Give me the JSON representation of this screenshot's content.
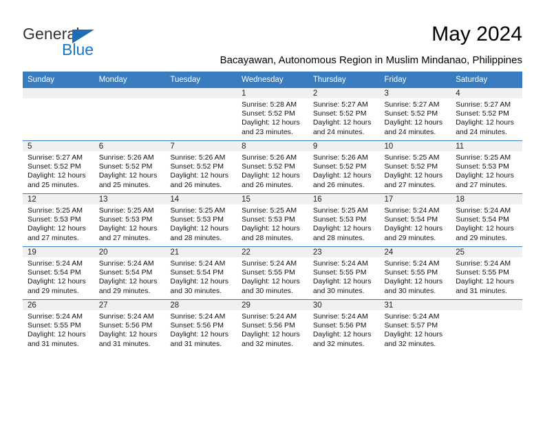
{
  "brand": {
    "name_top": "General",
    "name_bottom": "Blue",
    "triangle_color": "#1d6cb5",
    "text_color": "#333333",
    "blue_color": "#1874c6"
  },
  "header": {
    "title": "May 2024",
    "subtitle": "Bacayawan, Autonomous Region in Muslim Mindanao, Philippines"
  },
  "theme": {
    "header_row_bg": "#3a7cc0",
    "header_row_text": "#ffffff",
    "daynum_band_bg": "#f0f0f0",
    "cell_bg": "#ffffff",
    "week_divider": "#3a7cc0"
  },
  "weekdays": [
    "Sunday",
    "Monday",
    "Tuesday",
    "Wednesday",
    "Thursday",
    "Friday",
    "Saturday"
  ],
  "weeks": [
    [
      {
        "day": "",
        "lines": []
      },
      {
        "day": "",
        "lines": []
      },
      {
        "day": "",
        "lines": []
      },
      {
        "day": "1",
        "lines": [
          "Sunrise: 5:28 AM",
          "Sunset: 5:52 PM",
          "Daylight: 12 hours",
          "and 23 minutes."
        ]
      },
      {
        "day": "2",
        "lines": [
          "Sunrise: 5:27 AM",
          "Sunset: 5:52 PM",
          "Daylight: 12 hours",
          "and 24 minutes."
        ]
      },
      {
        "day": "3",
        "lines": [
          "Sunrise: 5:27 AM",
          "Sunset: 5:52 PM",
          "Daylight: 12 hours",
          "and 24 minutes."
        ]
      },
      {
        "day": "4",
        "lines": [
          "Sunrise: 5:27 AM",
          "Sunset: 5:52 PM",
          "Daylight: 12 hours",
          "and 24 minutes."
        ]
      }
    ],
    [
      {
        "day": "5",
        "lines": [
          "Sunrise: 5:27 AM",
          "Sunset: 5:52 PM",
          "Daylight: 12 hours",
          "and 25 minutes."
        ]
      },
      {
        "day": "6",
        "lines": [
          "Sunrise: 5:26 AM",
          "Sunset: 5:52 PM",
          "Daylight: 12 hours",
          "and 25 minutes."
        ]
      },
      {
        "day": "7",
        "lines": [
          "Sunrise: 5:26 AM",
          "Sunset: 5:52 PM",
          "Daylight: 12 hours",
          "and 26 minutes."
        ]
      },
      {
        "day": "8",
        "lines": [
          "Sunrise: 5:26 AM",
          "Sunset: 5:52 PM",
          "Daylight: 12 hours",
          "and 26 minutes."
        ]
      },
      {
        "day": "9",
        "lines": [
          "Sunrise: 5:26 AM",
          "Sunset: 5:52 PM",
          "Daylight: 12 hours",
          "and 26 minutes."
        ]
      },
      {
        "day": "10",
        "lines": [
          "Sunrise: 5:25 AM",
          "Sunset: 5:52 PM",
          "Daylight: 12 hours",
          "and 27 minutes."
        ]
      },
      {
        "day": "11",
        "lines": [
          "Sunrise: 5:25 AM",
          "Sunset: 5:53 PM",
          "Daylight: 12 hours",
          "and 27 minutes."
        ]
      }
    ],
    [
      {
        "day": "12",
        "lines": [
          "Sunrise: 5:25 AM",
          "Sunset: 5:53 PM",
          "Daylight: 12 hours",
          "and 27 minutes."
        ]
      },
      {
        "day": "13",
        "lines": [
          "Sunrise: 5:25 AM",
          "Sunset: 5:53 PM",
          "Daylight: 12 hours",
          "and 27 minutes."
        ]
      },
      {
        "day": "14",
        "lines": [
          "Sunrise: 5:25 AM",
          "Sunset: 5:53 PM",
          "Daylight: 12 hours",
          "and 28 minutes."
        ]
      },
      {
        "day": "15",
        "lines": [
          "Sunrise: 5:25 AM",
          "Sunset: 5:53 PM",
          "Daylight: 12 hours",
          "and 28 minutes."
        ]
      },
      {
        "day": "16",
        "lines": [
          "Sunrise: 5:25 AM",
          "Sunset: 5:53 PM",
          "Daylight: 12 hours",
          "and 28 minutes."
        ]
      },
      {
        "day": "17",
        "lines": [
          "Sunrise: 5:24 AM",
          "Sunset: 5:54 PM",
          "Daylight: 12 hours",
          "and 29 minutes."
        ]
      },
      {
        "day": "18",
        "lines": [
          "Sunrise: 5:24 AM",
          "Sunset: 5:54 PM",
          "Daylight: 12 hours",
          "and 29 minutes."
        ]
      }
    ],
    [
      {
        "day": "19",
        "lines": [
          "Sunrise: 5:24 AM",
          "Sunset: 5:54 PM",
          "Daylight: 12 hours",
          "and 29 minutes."
        ]
      },
      {
        "day": "20",
        "lines": [
          "Sunrise: 5:24 AM",
          "Sunset: 5:54 PM",
          "Daylight: 12 hours",
          "and 29 minutes."
        ]
      },
      {
        "day": "21",
        "lines": [
          "Sunrise: 5:24 AM",
          "Sunset: 5:54 PM",
          "Daylight: 12 hours",
          "and 30 minutes."
        ]
      },
      {
        "day": "22",
        "lines": [
          "Sunrise: 5:24 AM",
          "Sunset: 5:55 PM",
          "Daylight: 12 hours",
          "and 30 minutes."
        ]
      },
      {
        "day": "23",
        "lines": [
          "Sunrise: 5:24 AM",
          "Sunset: 5:55 PM",
          "Daylight: 12 hours",
          "and 30 minutes."
        ]
      },
      {
        "day": "24",
        "lines": [
          "Sunrise: 5:24 AM",
          "Sunset: 5:55 PM",
          "Daylight: 12 hours",
          "and 30 minutes."
        ]
      },
      {
        "day": "25",
        "lines": [
          "Sunrise: 5:24 AM",
          "Sunset: 5:55 PM",
          "Daylight: 12 hours",
          "and 31 minutes."
        ]
      }
    ],
    [
      {
        "day": "26",
        "lines": [
          "Sunrise: 5:24 AM",
          "Sunset: 5:55 PM",
          "Daylight: 12 hours",
          "and 31 minutes."
        ]
      },
      {
        "day": "27",
        "lines": [
          "Sunrise: 5:24 AM",
          "Sunset: 5:56 PM",
          "Daylight: 12 hours",
          "and 31 minutes."
        ]
      },
      {
        "day": "28",
        "lines": [
          "Sunrise: 5:24 AM",
          "Sunset: 5:56 PM",
          "Daylight: 12 hours",
          "and 31 minutes."
        ]
      },
      {
        "day": "29",
        "lines": [
          "Sunrise: 5:24 AM",
          "Sunset: 5:56 PM",
          "Daylight: 12 hours",
          "and 32 minutes."
        ]
      },
      {
        "day": "30",
        "lines": [
          "Sunrise: 5:24 AM",
          "Sunset: 5:56 PM",
          "Daylight: 12 hours",
          "and 32 minutes."
        ]
      },
      {
        "day": "31",
        "lines": [
          "Sunrise: 5:24 AM",
          "Sunset: 5:57 PM",
          "Daylight: 12 hours",
          "and 32 minutes."
        ]
      },
      {
        "day": "",
        "lines": []
      }
    ]
  ]
}
